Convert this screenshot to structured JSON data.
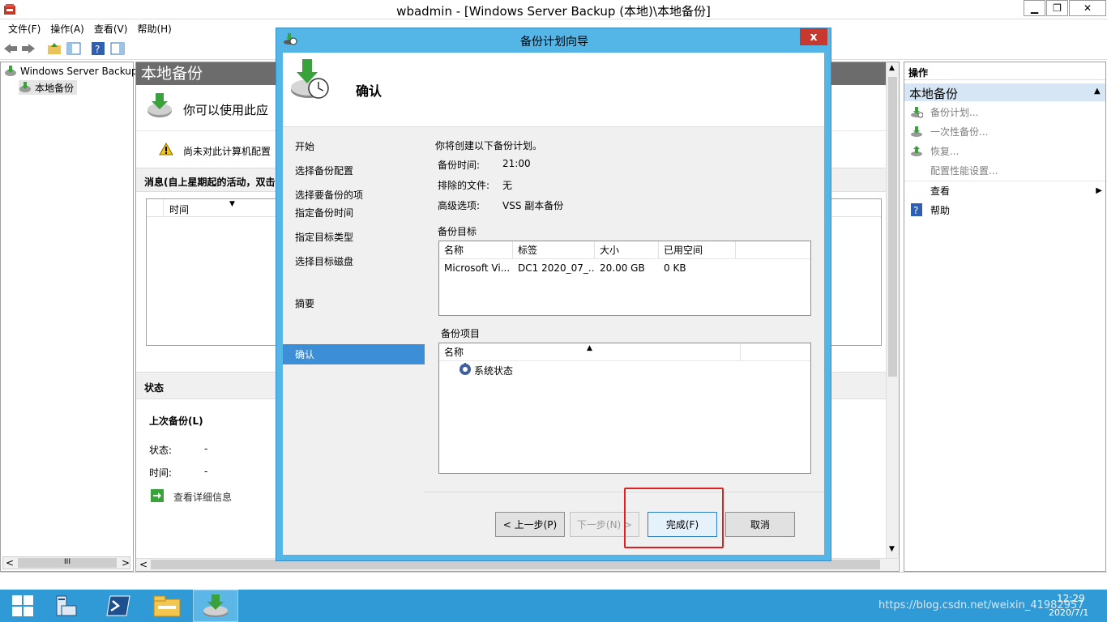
{
  "window": {
    "title": "wbadmin - [Windows Server Backup (本地)\\本地备份]",
    "minimize": "▁",
    "maximize": "❐",
    "close": "✕"
  },
  "menu": [
    "文件(F)",
    "操作(A)",
    "查看(V)",
    "帮助(H)"
  ],
  "tree": {
    "root": "Windows Server Backup",
    "child": "本地备份"
  },
  "center": {
    "header": "本地备份",
    "intro": "你可以使用此应",
    "warning": "尚未对此计算机配置",
    "messages_header": "消息(自上星期起的活动，双击",
    "table_col_time": "时间",
    "status_header": "状态",
    "last_backup": "上次备份(L)",
    "status_label": "状态:",
    "status_value": "-",
    "time_label": "时间:",
    "time_value": "-",
    "details_link": "查看详细信息",
    "scroll_left": "<",
    "scroll_right": ">",
    "scroll_grip": "III"
  },
  "actions": {
    "title": "操作",
    "section": "本地备份",
    "items": [
      "备份计划...",
      "一次性备份...",
      "恢复...",
      "配置性能设置...",
      "查看",
      "帮助"
    ]
  },
  "dialog": {
    "title": "备份计划向导",
    "close": "x",
    "heading": "确认",
    "nav": [
      "开始",
      "选择备份配置",
      "选择要备份的项",
      "指定备份时间",
      "指定目标类型",
      "选择目标磁盘",
      "确认",
      "摘要"
    ],
    "summary_line": "你将创建以下备份计划。",
    "fields": [
      {
        "label": "备份时间:",
        "value": "21:00"
      },
      {
        "label": "排除的文件:",
        "value": "无"
      },
      {
        "label": "高级选项:",
        "value": "VSS 副本备份"
      }
    ],
    "target_title": "备份目标",
    "target_columns": [
      "名称",
      "标签",
      "大小",
      "已用空间"
    ],
    "target_row": [
      "Microsoft Vi...",
      "DC1 2020_07_...",
      "20.00 GB",
      "0 KB"
    ],
    "items_title": "备份项目",
    "items_column": "名称",
    "items": [
      "系统状态"
    ],
    "buttons": {
      "back": "< 上一步(P)",
      "next": "下一步(N) >",
      "finish": "完成(F)",
      "cancel": "取消"
    }
  },
  "taskbar": {
    "time": "12:29",
    "date": "2020/7/1",
    "watermark": "https://blog.csdn.net/weixin_41982957"
  },
  "colors": {
    "dialog_frame": "#53b6e6",
    "taskbar": "#2f9ad6",
    "nav_active": "#3c8ed6",
    "highlight_box": "#e02020"
  }
}
